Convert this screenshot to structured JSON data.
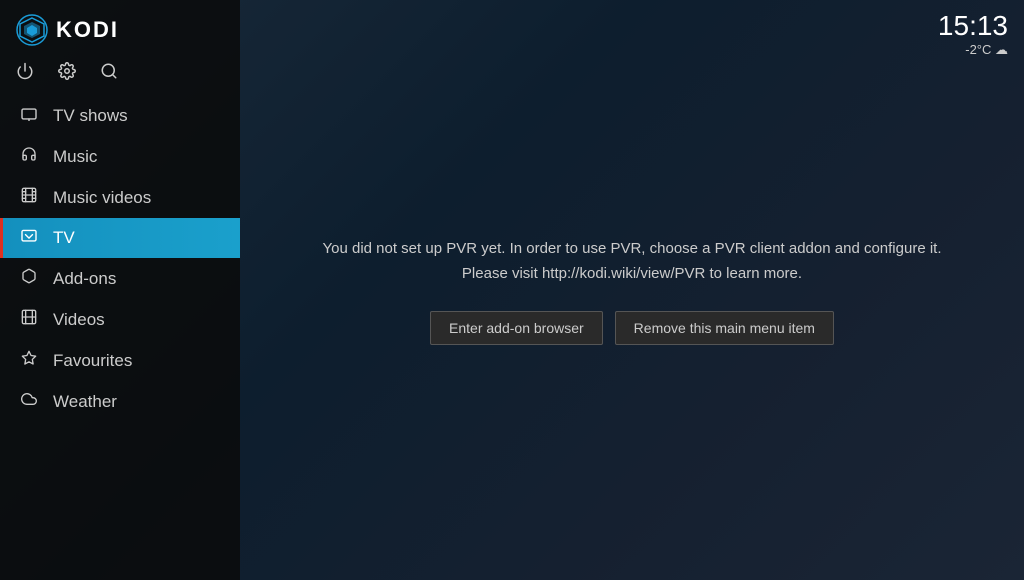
{
  "app": {
    "title": "KODI"
  },
  "clock": {
    "time": "15:13",
    "weather": "-2°C ☁"
  },
  "sidebar": {
    "icons": [
      {
        "name": "power-icon",
        "symbol": "⏻"
      },
      {
        "name": "settings-icon",
        "symbol": "⚙"
      },
      {
        "name": "search-icon",
        "symbol": "🔍"
      }
    ],
    "nav_items": [
      {
        "id": "tv-shows",
        "label": "TV shows",
        "icon": "🖥",
        "active": false
      },
      {
        "id": "music",
        "label": "Music",
        "icon": "🎧",
        "active": false
      },
      {
        "id": "music-videos",
        "label": "Music videos",
        "icon": "🎞",
        "active": false
      },
      {
        "id": "tv",
        "label": "TV",
        "icon": "📺",
        "active": true
      },
      {
        "id": "add-ons",
        "label": "Add-ons",
        "icon": "🎓",
        "active": false
      },
      {
        "id": "videos",
        "label": "Videos",
        "icon": "🎬",
        "active": false
      },
      {
        "id": "favourites",
        "label": "Favourites",
        "icon": "⭐",
        "active": false
      },
      {
        "id": "weather",
        "label": "Weather",
        "icon": "🌤",
        "active": false
      }
    ]
  },
  "main": {
    "pvr_message_line1": "You did not set up PVR yet. In order to use PVR, choose a PVR client addon and configure it.",
    "pvr_message_line2": "Please visit http://kodi.wiki/view/PVR to learn more.",
    "btn_enter_addon": "Enter add-on browser",
    "btn_remove_menu": "Remove this main menu item"
  }
}
